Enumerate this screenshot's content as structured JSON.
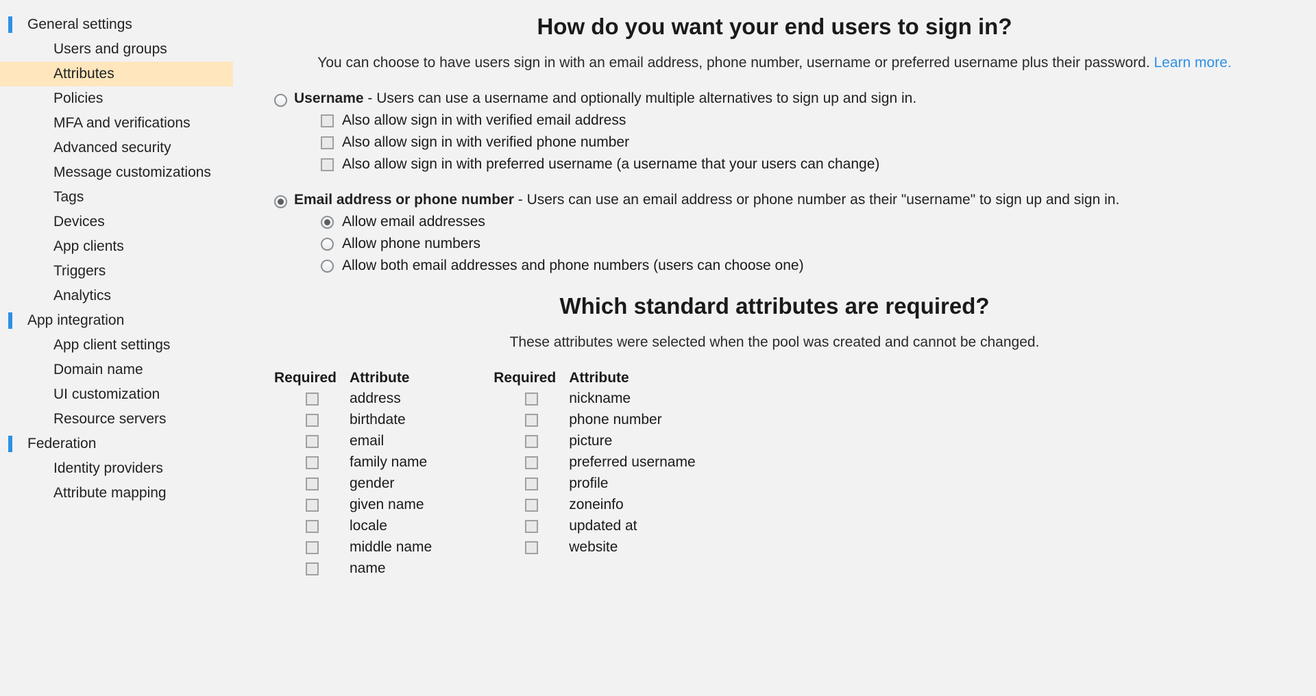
{
  "sidebar": {
    "sections": [
      {
        "label": "General settings",
        "items": [
          {
            "label": "Users and groups",
            "active": false
          },
          {
            "label": "Attributes",
            "active": true
          },
          {
            "label": "Policies",
            "active": false
          },
          {
            "label": "MFA and verifications",
            "active": false
          },
          {
            "label": "Advanced security",
            "active": false
          },
          {
            "label": "Message customizations",
            "active": false
          },
          {
            "label": "Tags",
            "active": false
          },
          {
            "label": "Devices",
            "active": false
          },
          {
            "label": "App clients",
            "active": false
          },
          {
            "label": "Triggers",
            "active": false
          },
          {
            "label": "Analytics",
            "active": false
          }
        ]
      },
      {
        "label": "App integration",
        "items": [
          {
            "label": "App client settings",
            "active": false
          },
          {
            "label": "Domain name",
            "active": false
          },
          {
            "label": "UI customization",
            "active": false
          },
          {
            "label": "Resource servers",
            "active": false
          }
        ]
      },
      {
        "label": "Federation",
        "items": [
          {
            "label": "Identity providers",
            "active": false
          },
          {
            "label": "Attribute mapping",
            "active": false
          }
        ]
      }
    ]
  },
  "signin": {
    "heading": "How do you want your end users to sign in?",
    "subtext_pre": "You can choose to have users sign in with an email address, phone number, username or preferred username plus their password. ",
    "learn_more": "Learn more.",
    "option_username": {
      "label": "Username",
      "desc": " - Users can use a username and optionally multiple alternatives to sign up and sign in.",
      "selected": false,
      "subs": [
        {
          "label": "Also allow sign in with verified email address"
        },
        {
          "label": "Also allow sign in with verified phone number"
        },
        {
          "label": "Also allow sign in with preferred username (a username that your users can change)"
        }
      ]
    },
    "option_email_phone": {
      "label": "Email address or phone number",
      "desc": " - Users can use an email address or phone number as their \"username\" to sign up and sign in.",
      "selected": true,
      "subs": [
        {
          "label": "Allow email addresses",
          "selected": true
        },
        {
          "label": "Allow phone numbers",
          "selected": false
        },
        {
          "label": "Allow both email addresses and phone numbers (users can choose one)",
          "selected": false
        }
      ]
    }
  },
  "attributes": {
    "heading": "Which standard attributes are required?",
    "subtext": "These attributes were selected when the pool was created and cannot be changed.",
    "col_required": "Required",
    "col_attribute": "Attribute",
    "left": [
      {
        "name": "address"
      },
      {
        "name": "birthdate"
      },
      {
        "name": "email"
      },
      {
        "name": "family name"
      },
      {
        "name": "gender"
      },
      {
        "name": "given name"
      },
      {
        "name": "locale"
      },
      {
        "name": "middle name"
      },
      {
        "name": "name"
      }
    ],
    "right": [
      {
        "name": "nickname"
      },
      {
        "name": "phone number"
      },
      {
        "name": "picture"
      },
      {
        "name": "preferred username"
      },
      {
        "name": "profile"
      },
      {
        "name": "zoneinfo"
      },
      {
        "name": "updated at"
      },
      {
        "name": "website"
      }
    ]
  }
}
